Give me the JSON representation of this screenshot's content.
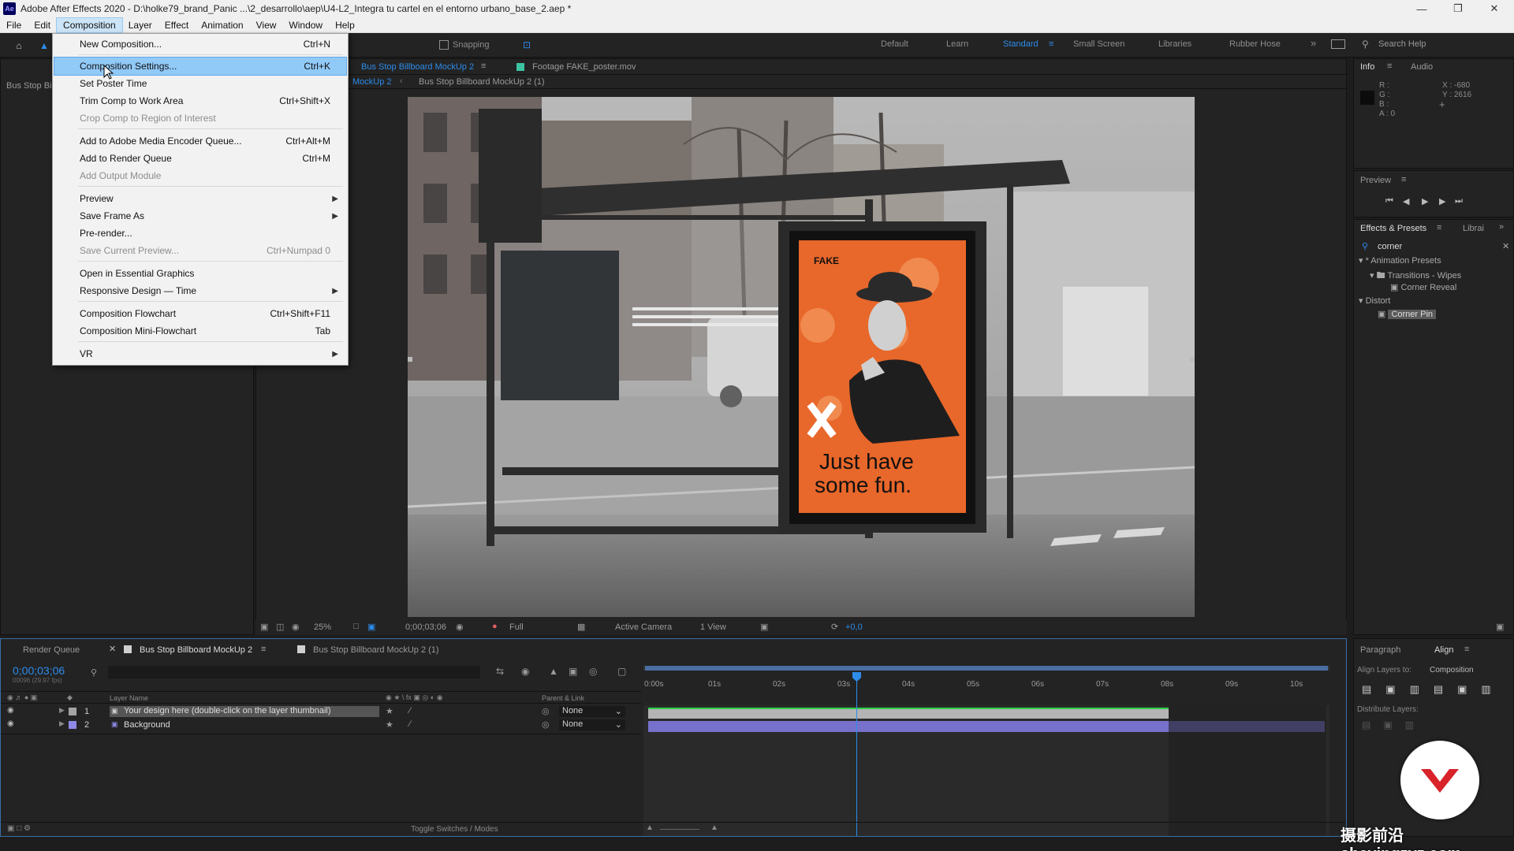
{
  "window": {
    "title": "Adobe After Effects 2020 - D:\\holke79_brand_Panic ...\\2_desarrollo\\aep\\U4-L2_Integra tu cartel en el entorno urbano_base_2.aep *",
    "app_badge": "Ae"
  },
  "menubar": [
    "File",
    "Edit",
    "Composition",
    "Layer",
    "Effect",
    "Animation",
    "View",
    "Window",
    "Help"
  ],
  "workspaces": [
    "Default",
    "Learn",
    "Standard",
    "Small Screen",
    "Libraries",
    "Rubber Hose"
  ],
  "toolbar": {
    "snapping": "Snapping",
    "search_help": "Search Help"
  },
  "composition_menu": {
    "items": [
      {
        "label": "New Composition...",
        "shortcut": "Ctrl+N"
      },
      {
        "label": "Composition Settings...",
        "shortcut": "Ctrl+K"
      },
      {
        "label": "Set Poster Time",
        "shortcut": ""
      },
      {
        "label": "Trim Comp to Work Area",
        "shortcut": "Ctrl+Shift+X"
      },
      {
        "label": "Crop Comp to Region of Interest",
        "shortcut": ""
      },
      {
        "label": "Add to Adobe Media Encoder Queue...",
        "shortcut": "Ctrl+Alt+M"
      },
      {
        "label": "Add to Render Queue",
        "shortcut": "Ctrl+M"
      },
      {
        "label": "Add Output Module",
        "shortcut": ""
      },
      {
        "label": "Preview",
        "shortcut": ""
      },
      {
        "label": "Save Frame As",
        "shortcut": ""
      },
      {
        "label": "Pre-render...",
        "shortcut": ""
      },
      {
        "label": "Save Current Preview...",
        "shortcut": "Ctrl+Numpad 0"
      },
      {
        "label": "Open in Essential Graphics",
        "shortcut": ""
      },
      {
        "label": "Responsive Design — Time",
        "shortcut": ""
      },
      {
        "label": "Composition Flowchart",
        "shortcut": "Ctrl+Shift+F11"
      },
      {
        "label": "Composition Mini-Flowchart",
        "shortcut": "Tab"
      },
      {
        "label": "VR",
        "shortcut": ""
      }
    ]
  },
  "comp_panel": {
    "tab_label": "Bus Stop Billboard MockUp 2",
    "footage_label": "Footage FAKE_poster.mov",
    "breadcrumb_1": "MockUp 2",
    "breadcrumb_2": "Bus Stop Billboard MockUp 2 (1)",
    "project_tab": "Bus Stop Bil"
  },
  "poster": {
    "brand": "FAKE",
    "headline_1": "Just have",
    "headline_2": "some fun."
  },
  "viewer_controls": {
    "zoom": "25%",
    "timecode": "0;00;03;06",
    "resolution": "Full",
    "camera": "Active Camera",
    "view": "1 View",
    "exposure": "+0,0"
  },
  "info_panel": {
    "tab": "Info",
    "tab2": "Audio",
    "r": "R :",
    "g": "G :",
    "b": "B :",
    "a": "A : 0",
    "x": "X : -680",
    "y": "Y : 2616"
  },
  "preview_panel": {
    "title": "Preview"
  },
  "effects_panel": {
    "title": "Effects & Presets",
    "tab2": "Librai",
    "search": "corner",
    "tree": [
      "* Animation Presets",
      "Transitions - Wipes",
      "Corner Reveal",
      "Distort",
      "Corner Pin"
    ]
  },
  "timeline": {
    "tabs": [
      "Render Queue",
      "Bus Stop Billboard MockUp 2",
      "Bus Stop Billboard MockUp 2 (1)"
    ],
    "timecode": "0;00;03;06",
    "fps": "00096 (29.97 fps)",
    "col_layer_name": "Layer Name",
    "col_parent": "Parent & Link",
    "layers": [
      {
        "num": "1",
        "name": "Your design here (double-click on the layer thumbnail)",
        "parent": "None",
        "color": "#a4a4a4"
      },
      {
        "num": "2",
        "name": "Background",
        "parent": "None",
        "color": "#8e88e6"
      }
    ],
    "ruler": [
      "0:00s",
      "01s",
      "02s",
      "03s",
      "04s",
      "05s",
      "06s",
      "07s",
      "08s",
      "09s",
      "10s"
    ],
    "footer": "Toggle Switches / Modes"
  },
  "align_panel": {
    "tab1": "Paragraph",
    "tab2": "Align",
    "align_to_label": "Align Layers to:",
    "align_to_value": "Composition",
    "distribute": "Distribute Layers:"
  },
  "watermark": "摄影前沿 sheyingzyz.com"
}
